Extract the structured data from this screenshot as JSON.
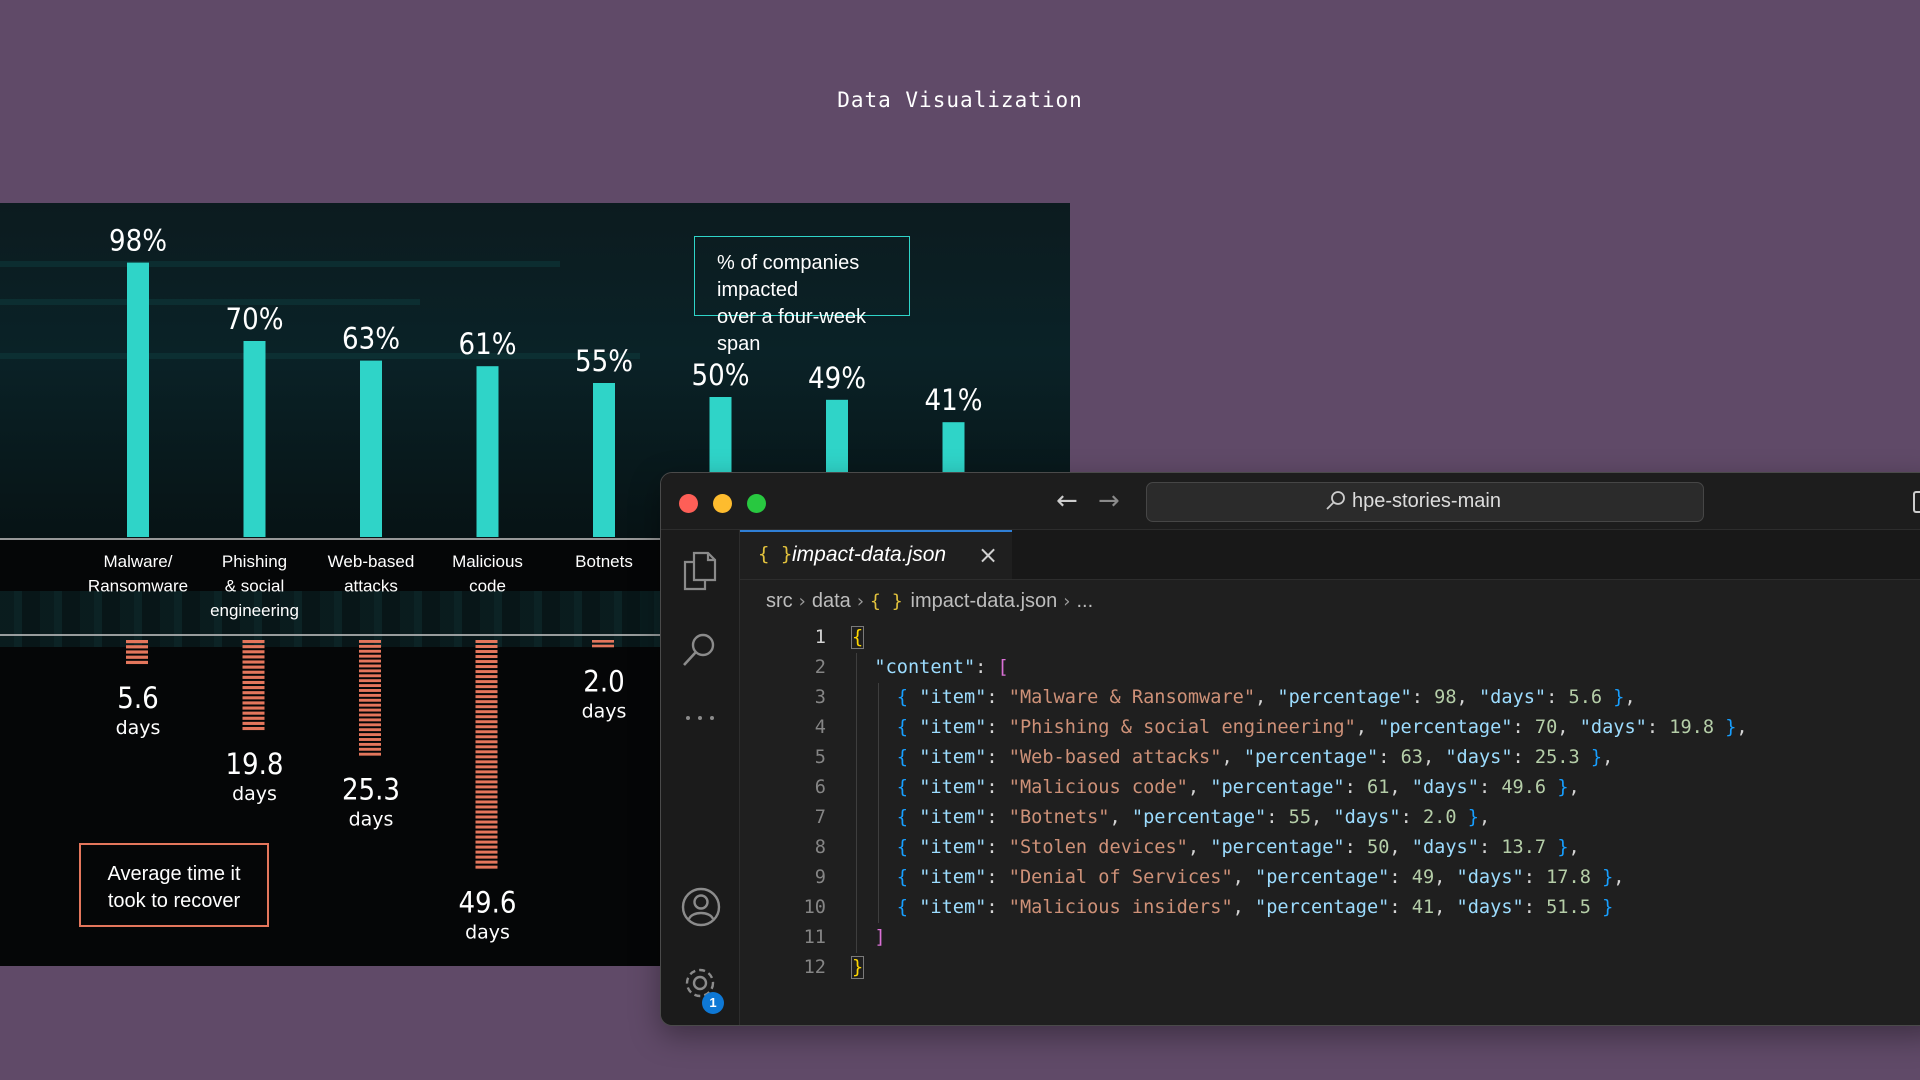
{
  "page": {
    "title": "Data Visualization"
  },
  "chart_data": {
    "type": "bar",
    "categories": [
      "Malware/\nRansomware",
      "Phishing\n& social\nengineering",
      "Web-based\nattacks",
      "Malicious\ncode",
      "Botnets",
      "Stolen devices",
      "Denial of Services",
      "Malicious insiders"
    ],
    "series": [
      {
        "name": "% of companies impacted\nover a four-week span",
        "values": [
          98,
          70,
          63,
          61,
          55,
          50,
          49,
          41
        ],
        "labels": [
          "98%",
          "70%",
          "63%",
          "61%",
          "55%",
          "50%",
          "49%",
          "41%"
        ]
      },
      {
        "name": "Average time it\ntook to recover",
        "values": [
          5.6,
          19.8,
          25.3,
          49.6,
          2.0,
          13.7,
          17.8,
          51.5
        ],
        "labels": [
          "5.6",
          "19.8",
          "25.3",
          "49.6",
          "2.0",
          "",
          "",
          ""
        ]
      }
    ],
    "visible_label_categories": 5,
    "unit_label": "days",
    "colors": {
      "percentage": "#2fd4c8",
      "days": "#e4765c"
    }
  },
  "editor": {
    "search_text": "hpe-stories-main",
    "tab": {
      "icon": "{ }",
      "label": "impact-data.json"
    },
    "breadcrumb": [
      "src",
      "data",
      "impact-data.json",
      "..."
    ],
    "active_line": 1,
    "badge_count": "1",
    "lines": [
      {
        "n": "1",
        "indent": 0,
        "tokens": [
          [
            "b1 hl",
            "{"
          ]
        ]
      },
      {
        "n": "2",
        "indent": 1,
        "tokens": [
          [
            "k",
            "\"content\""
          ],
          [
            "p",
            ": "
          ],
          [
            "b2",
            "["
          ]
        ]
      },
      {
        "n": "3",
        "indent": 2,
        "tokens": [
          [
            "b3",
            "{ "
          ],
          [
            "k",
            "\"item\""
          ],
          [
            "p",
            ": "
          ],
          [
            "s",
            "\"Malware & Ransomware\""
          ],
          [
            "p",
            ", "
          ],
          [
            "k",
            "\"percentage\""
          ],
          [
            "p",
            ": "
          ],
          [
            "n",
            "98"
          ],
          [
            "p",
            ", "
          ],
          [
            "k",
            "\"days\""
          ],
          [
            "p",
            ": "
          ],
          [
            "n",
            "5.6"
          ],
          [
            "b3",
            " }"
          ],
          [
            "p",
            ","
          ]
        ]
      },
      {
        "n": "4",
        "indent": 2,
        "tokens": [
          [
            "b3",
            "{ "
          ],
          [
            "k",
            "\"item\""
          ],
          [
            "p",
            ": "
          ],
          [
            "s",
            "\"Phishing & social engineering\""
          ],
          [
            "p",
            ", "
          ],
          [
            "k",
            "\"percentage\""
          ],
          [
            "p",
            ": "
          ],
          [
            "n",
            "70"
          ],
          [
            "p",
            ", "
          ],
          [
            "k",
            "\"days\""
          ],
          [
            "p",
            ": "
          ],
          [
            "n",
            "19.8"
          ],
          [
            "b3",
            " }"
          ],
          [
            "p",
            ","
          ]
        ]
      },
      {
        "n": "5",
        "indent": 2,
        "tokens": [
          [
            "b3",
            "{ "
          ],
          [
            "k",
            "\"item\""
          ],
          [
            "p",
            ": "
          ],
          [
            "s",
            "\"Web-based attacks\""
          ],
          [
            "p",
            ", "
          ],
          [
            "k",
            "\"percentage\""
          ],
          [
            "p",
            ": "
          ],
          [
            "n",
            "63"
          ],
          [
            "p",
            ", "
          ],
          [
            "k",
            "\"days\""
          ],
          [
            "p",
            ": "
          ],
          [
            "n",
            "25.3"
          ],
          [
            "b3",
            " }"
          ],
          [
            "p",
            ","
          ]
        ]
      },
      {
        "n": "6",
        "indent": 2,
        "tokens": [
          [
            "b3",
            "{ "
          ],
          [
            "k",
            "\"item\""
          ],
          [
            "p",
            ": "
          ],
          [
            "s",
            "\"Malicious code\""
          ],
          [
            "p",
            ", "
          ],
          [
            "k",
            "\"percentage\""
          ],
          [
            "p",
            ": "
          ],
          [
            "n",
            "61"
          ],
          [
            "p",
            ", "
          ],
          [
            "k",
            "\"days\""
          ],
          [
            "p",
            ": "
          ],
          [
            "n",
            "49.6"
          ],
          [
            "b3",
            " }"
          ],
          [
            "p",
            ","
          ]
        ]
      },
      {
        "n": "7",
        "indent": 2,
        "tokens": [
          [
            "b3",
            "{ "
          ],
          [
            "k",
            "\"item\""
          ],
          [
            "p",
            ": "
          ],
          [
            "s",
            "\"Botnets\""
          ],
          [
            "p",
            ", "
          ],
          [
            "k",
            "\"percentage\""
          ],
          [
            "p",
            ": "
          ],
          [
            "n",
            "55"
          ],
          [
            "p",
            ", "
          ],
          [
            "k",
            "\"days\""
          ],
          [
            "p",
            ": "
          ],
          [
            "n",
            "2.0"
          ],
          [
            "b3",
            " }"
          ],
          [
            "p",
            ","
          ]
        ]
      },
      {
        "n": "8",
        "indent": 2,
        "tokens": [
          [
            "b3",
            "{ "
          ],
          [
            "k",
            "\"item\""
          ],
          [
            "p",
            ": "
          ],
          [
            "s",
            "\"Stolen devices\""
          ],
          [
            "p",
            ", "
          ],
          [
            "k",
            "\"percentage\""
          ],
          [
            "p",
            ": "
          ],
          [
            "n",
            "50"
          ],
          [
            "p",
            ", "
          ],
          [
            "k",
            "\"days\""
          ],
          [
            "p",
            ": "
          ],
          [
            "n",
            "13.7"
          ],
          [
            "b3",
            " }"
          ],
          [
            "p",
            ","
          ]
        ]
      },
      {
        "n": "9",
        "indent": 2,
        "tokens": [
          [
            "b3",
            "{ "
          ],
          [
            "k",
            "\"item\""
          ],
          [
            "p",
            ": "
          ],
          [
            "s",
            "\"Denial of Services\""
          ],
          [
            "p",
            ", "
          ],
          [
            "k",
            "\"percentage\""
          ],
          [
            "p",
            ": "
          ],
          [
            "n",
            "49"
          ],
          [
            "p",
            ", "
          ],
          [
            "k",
            "\"days\""
          ],
          [
            "p",
            ": "
          ],
          [
            "n",
            "17.8"
          ],
          [
            "b3",
            " }"
          ],
          [
            "p",
            ","
          ]
        ]
      },
      {
        "n": "10",
        "indent": 2,
        "tokens": [
          [
            "b3",
            "{ "
          ],
          [
            "k",
            "\"item\""
          ],
          [
            "p",
            ": "
          ],
          [
            "s",
            "\"Malicious insiders\""
          ],
          [
            "p",
            ", "
          ],
          [
            "k",
            "\"percentage\""
          ],
          [
            "p",
            ": "
          ],
          [
            "n",
            "41"
          ],
          [
            "p",
            ", "
          ],
          [
            "k",
            "\"days\""
          ],
          [
            "p",
            ": "
          ],
          [
            "n",
            "51.5"
          ],
          [
            "b3",
            " }"
          ]
        ]
      },
      {
        "n": "11",
        "indent": 1,
        "tokens": [
          [
            "b2",
            "]"
          ]
        ]
      },
      {
        "n": "12",
        "indent": 0,
        "tokens": [
          [
            "b1 hl",
            "}"
          ]
        ]
      }
    ]
  }
}
